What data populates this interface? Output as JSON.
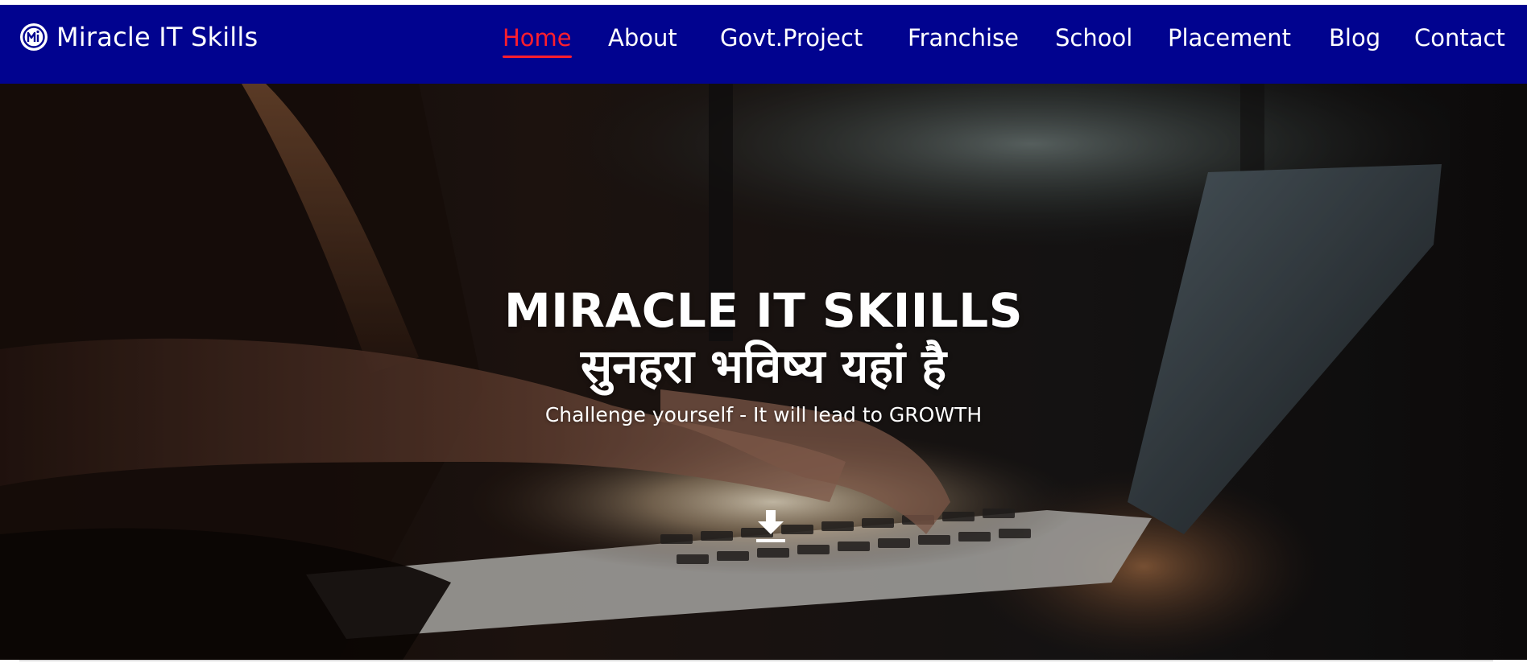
{
  "brand": {
    "name": "Miracle IT Skills",
    "logo_icon": "mi-logo-icon"
  },
  "nav": {
    "items": [
      {
        "label": "Home",
        "active": true
      },
      {
        "label": "About",
        "active": false
      },
      {
        "label": "Govt.Project",
        "active": false
      },
      {
        "label": "Franchise",
        "active": false
      },
      {
        "label": "School",
        "active": false
      },
      {
        "label": "Placement",
        "active": false
      },
      {
        "label": "Blog",
        "active": false
      },
      {
        "label": "Contact",
        "active": false
      }
    ]
  },
  "hero": {
    "title": "MIRACLE IT SKIILLS",
    "hindi_title": "सुनहरा भविष्य यहां है",
    "tagline": "Challenge yourself - It will lead to GROWTH",
    "scroll_icon": "download-arrow-icon",
    "background": "photo-hands-typing-on-laptop"
  },
  "colors": {
    "navbar_bg": "#01038f",
    "active_link": "#ff1e2d",
    "text": "#ffffff"
  }
}
